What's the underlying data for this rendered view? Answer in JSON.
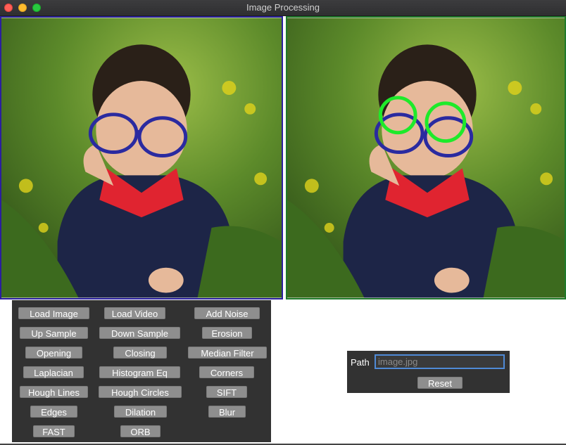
{
  "window": {
    "title": "Image Processing",
    "controls": [
      "close",
      "minimize",
      "zoom"
    ]
  },
  "images": {
    "original": {
      "border_color": "#2a1f9e"
    },
    "processed": {
      "border_color": "#1f7a2a",
      "detections": "green-circles"
    }
  },
  "buttons": {
    "load_image": "Load Image",
    "load_video": "Load Video",
    "add_noise": "Add Noise",
    "up_sample": "Up Sample",
    "down_sample": "Down Sample",
    "erosion": "Erosion",
    "opening": "Opening",
    "closing": "Closing",
    "median_filter": "Median Filter",
    "laplacian": "Laplacian",
    "histogram_eq": "Histogram Eq",
    "corners": "Corners",
    "hough_lines": "Hough Lines",
    "hough_circles": "Hough Circles",
    "sift": "SIFT",
    "edges": "Edges",
    "dilation": "Dilation",
    "blur": "Blur",
    "fast": "FAST",
    "orb": "ORB"
  },
  "path_panel": {
    "label": "Path",
    "input_value": "image.jpg",
    "reset_label": "Reset"
  }
}
